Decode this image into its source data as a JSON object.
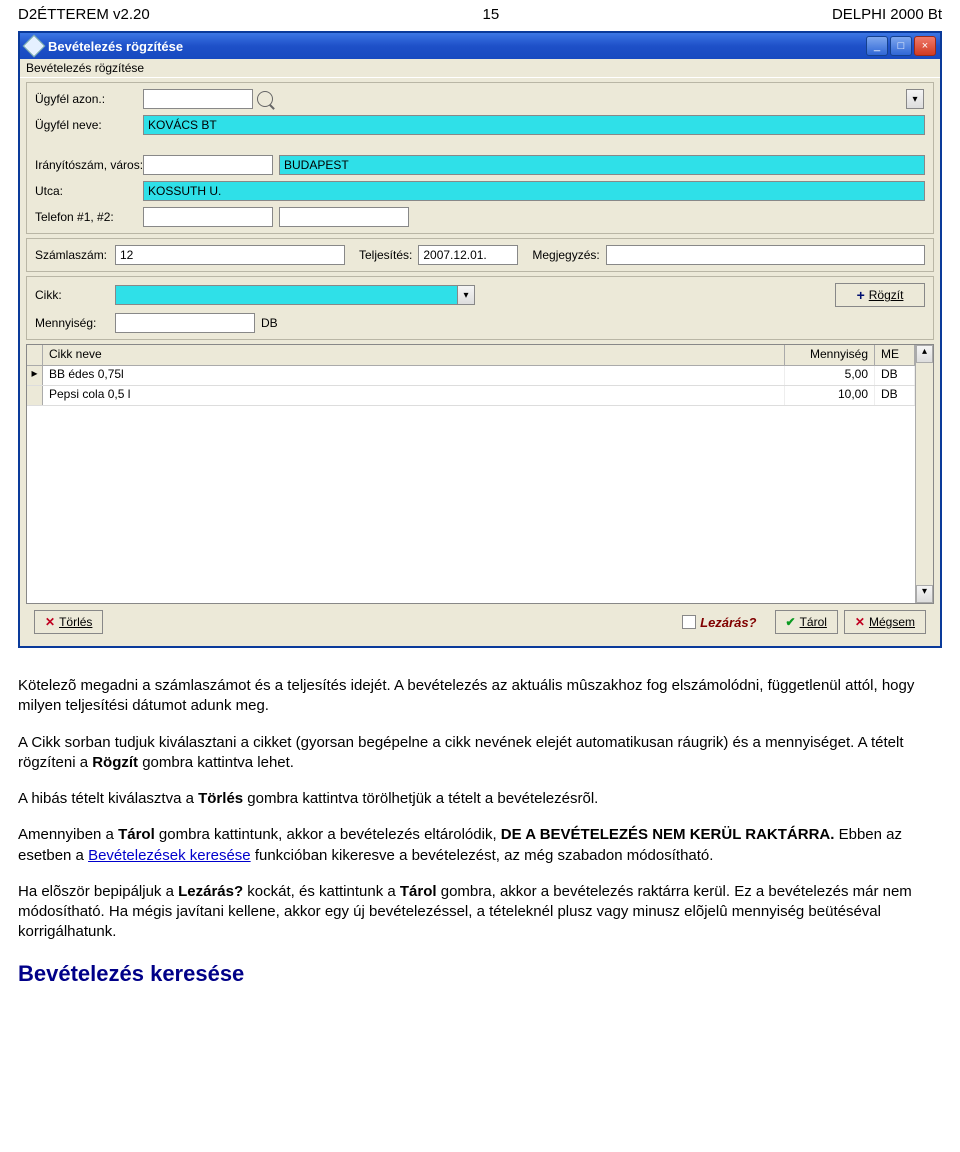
{
  "header": {
    "left": "D2ÉTTEREM v2.20",
    "center": "15",
    "right": "DELPHI 2000 Bt"
  },
  "window": {
    "title": "Bevételezés rögzítése",
    "menu": "Bevételezés rögzítése"
  },
  "fields": {
    "ugyfel_azon_label": "Ügyfél azon.:",
    "ugyfel_azon_value": "",
    "ugyfel_neve_label": "Ügyfél neve:",
    "ugyfel_neve_value": "KOVÁCS BT",
    "irsz_label": "Irányítószám, város:",
    "irsz_value": "",
    "varos_value": "BUDAPEST",
    "utca_label": "Utca:",
    "utca_value": "KOSSUTH U.",
    "telefon_label": "Telefon #1, #2:",
    "tel1_value": "",
    "tel2_value": "",
    "szamlaszam_label": "Számlaszám:",
    "szamlaszam_value": "12",
    "teljesites_label": "Teljesítés:",
    "teljesites_value": "2007.12.01.",
    "megjegyzes_label": "Megjegyzés:",
    "megjegyzes_value": "",
    "cikk_label": "Cikk:",
    "cikk_value": "",
    "mennyiseg_label": "Mennyiség:",
    "mennyiseg_value": "",
    "unit": "DB",
    "rogzit_btn": "Rögzít"
  },
  "grid": {
    "col_name": "Cikk neve",
    "col_qty": "Mennyiség",
    "col_me": "ME",
    "rows": [
      {
        "name": "BB édes 0,75l",
        "qty": "5,00",
        "me": "DB"
      },
      {
        "name": "Pepsi cola 0,5 l",
        "qty": "10,00",
        "me": "DB"
      }
    ]
  },
  "bottom": {
    "torles": "Törlés",
    "lezaras": "Lezárás?",
    "tarol": "Tárol",
    "megsem": "Mégsem"
  },
  "doc": {
    "p1": "Kötelezõ megadni a számlaszámot és a teljesítés idejét. A bevételezés az aktuális mûszakhoz fog elszámolódni, függetlenül attól, hogy milyen teljesítési dátumot adunk meg.",
    "p2_a": "A Cikk sorban tudjuk kiválasztani a cikket (gyorsan begépelne a cikk nevének elejét automatikusan ráugrik) és a mennyiséget. A tételt rögzíteni a ",
    "p2_b": "Rögzít",
    "p2_c": " gombra kattintva lehet.",
    "p3_a": "A hibás tételt kiválasztva a ",
    "p3_b": "Törlés",
    "p3_c": " gombra kattintva törölhetjük a tételt a bevételezésrõl.",
    "p4_a": "Amennyiben a ",
    "p4_b": "Tárol",
    "p4_c": " gombra kattintunk, akkor a bevételezés eltárolódik, ",
    "p4_d": "DE A BEVÉTELEZÉS NEM KERÜL RAKTÁRRA.",
    "p4_e": " Ebben az esetben a ",
    "p4_link": "Bevételezések keresése",
    "p4_f": " funkcióban kikeresve a bevételezést, az még szabadon módosítható.",
    "p5_a": "Ha elõször bepipáljuk a ",
    "p5_b": "Lezárás?",
    "p5_c": " kockát, és kattintunk a ",
    "p5_d": "Tárol",
    "p5_e": " gombra, akkor a bevételezés raktárra kerül. Ez a bevételezés már nem módosítható. Ha mégis javítani kellene, akkor egy új bevételezéssel, a tételeknél plusz vagy minusz elõjelû mennyiség beütéséval korrigálhatunk.",
    "h2": "Bevételezés keresése"
  }
}
